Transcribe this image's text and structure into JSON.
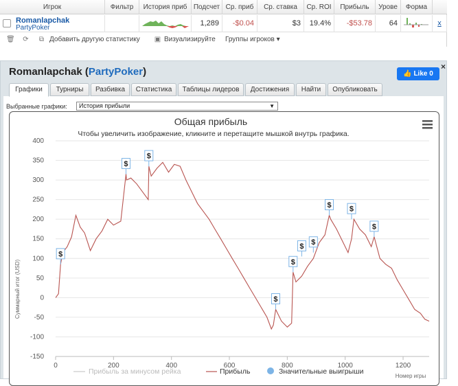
{
  "table": {
    "headers": [
      "Игрок",
      "Фильтр",
      "История приб",
      "Подсчет",
      "Ср. приб",
      "Ср. ставка",
      "Ср. ROI",
      "Прибыль",
      "Урове",
      "Форма"
    ],
    "row": {
      "player": "Romanlapchak",
      "site": "PartyPoker",
      "count": "1,289",
      "avg_profit": "-$0.04",
      "avg_stake": "$3",
      "avg_roi": "19.4%",
      "profit": "-$53.78",
      "level": "64",
      "remove": "x"
    }
  },
  "toolbar": {
    "add_stats": "Добавить другую статистику",
    "visualize": "Визуализируйте",
    "groups": "Группы игроков"
  },
  "panel": {
    "player": "Romanlapchak",
    "site": "PartyPoker",
    "like_label": "Like 0",
    "close": "×",
    "tabs": [
      "Графики",
      "Турниры",
      "Разбивка",
      "Статистика",
      "Таблицы лидеров",
      "Достижения",
      "Найти",
      "Опубликовать"
    ],
    "selected_tab": "Графики",
    "selector_label": "Выбранные графики:",
    "selector_value": "История прибыли"
  },
  "chart_data": {
    "type": "line",
    "title": "Общая прибыль",
    "subtitle": "Чтобы увеличить изображение, кликните и перетащите мышкой внутрь графика.",
    "ylabel": "Суммарный итог (USD)",
    "xlabel": "Номер игры",
    "xlim": [
      0,
      1290
    ],
    "ylim": [
      -150,
      400
    ],
    "x_ticks": [
      "0",
      "200",
      "400",
      "600",
      "800",
      "1000",
      "1200"
    ],
    "y_ticks": [
      "400",
      "350",
      "300",
      "250",
      "200",
      "150",
      "100",
      "50",
      "0",
      "-50",
      "-100",
      "-150"
    ],
    "legend": [
      "Прибыль за минусом рейка",
      "Прибыль",
      "Значительные выигрыши"
    ],
    "series": [
      {
        "name": "Прибыль",
        "color": "#b85450",
        "x": [
          0,
          10,
          17,
          25,
          40,
          55,
          70,
          85,
          100,
          120,
          140,
          160,
          180,
          200,
          225,
          243,
          245,
          260,
          280,
          300,
          320,
          322,
          330,
          350,
          370,
          390,
          410,
          430,
          450,
          470,
          490,
          510,
          530,
          550,
          570,
          590,
          610,
          630,
          650,
          670,
          690,
          710,
          730,
          745,
          752,
          760,
          780,
          800,
          815,
          820,
          830,
          850,
          870,
          890,
          910,
          930,
          945,
          950,
          970,
          990,
          1010,
          1022,
          1030,
          1050,
          1070,
          1090,
          1100,
          1120,
          1140,
          1160,
          1180,
          1200,
          1220,
          1240,
          1260,
          1275,
          1290
        ],
        "values": [
          0,
          10,
          85,
          115,
          130,
          155,
          210,
          180,
          165,
          120,
          150,
          170,
          200,
          185,
          195,
          315,
          300,
          305,
          290,
          270,
          250,
          335,
          310,
          330,
          345,
          320,
          340,
          335,
          300,
          270,
          240,
          220,
          200,
          175,
          150,
          125,
          100,
          75,
          50,
          25,
          0,
          -25,
          -50,
          -80,
          -70,
          -30,
          -60,
          -75,
          -65,
          65,
          40,
          55,
          80,
          100,
          140,
          160,
          210,
          200,
          175,
          145,
          115,
          150,
          200,
          175,
          160,
          130,
          155,
          100,
          85,
          75,
          45,
          20,
          -5,
          -30,
          -40,
          -55,
          -60
        ]
      }
    ],
    "big_wins": [
      {
        "x": 17,
        "y": 85
      },
      {
        "x": 243,
        "y": 315
      },
      {
        "x": 322,
        "y": 335
      },
      {
        "x": 760,
        "y": -30
      },
      {
        "x": 820,
        "y": 65
      },
      {
        "x": 850,
        "y": 105
      },
      {
        "x": 890,
        "y": 115
      },
      {
        "x": 945,
        "y": 210
      },
      {
        "x": 1022,
        "y": 200
      },
      {
        "x": 1100,
        "y": 155
      }
    ],
    "marker_label": "$"
  }
}
